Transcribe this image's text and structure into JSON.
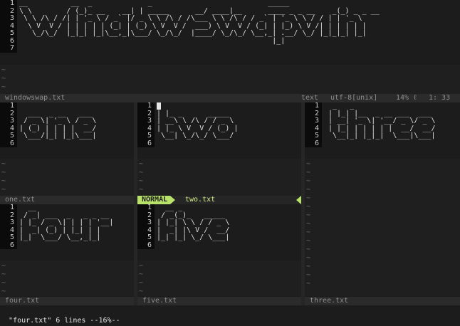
{
  "windows": {
    "top": {
      "file": "windowswap.txt",
      "lines": [
        "__          __  _             _                           _____                           ",
        "\\ \\        / (_)_ __    __| | _____      __/ ____|__      ____ _ _ __    _(_) _ _ __  ",
        " \\ \\ /\\ / /| | '_ \\ / _` |/ _ \\ \\ /\\ / /\\___ \\ \\ /\\ / / _` | '_ \\ \\ / / | | '_ \\ ",
        "  \\ V  V / | | | | | (_| | (_) \\ V  V /  ___) \\ V  V / (_| | |_) \\ V /| | | | | |",
        "   \\_/\\_/  |_|_| |_|\\__,_|\\___/ \\_/\\_/  |____/ \\_/\\_/ \\__,_| .__/ \\_/ |_|_|_| |_|",
        "                                                           |_|                      ",
        ""
      ],
      "line_numbers": [
        "1",
        "2",
        "3",
        "4",
        "5",
        "6",
        "7"
      ],
      "tildes": [
        "~",
        "~",
        "~"
      ],
      "filetype": "text",
      "encoding": "utf-8[unix]",
      "percent": "14%",
      "ln_icon": "ℓ",
      "position": "1: 33"
    },
    "one": {
      "file": "one.txt",
      "lines": [
        "",
        "  ___  _ __   ___ ",
        " / _ \\| '_ \\ / _ \\",
        "| (_) | | | |  __/",
        " \\___/|_| |_|\\___|",
        ""
      ],
      "line_numbers": [
        "1",
        "2",
        "3",
        "4",
        "5",
        "6"
      ],
      "tildes": [
        "~",
        "~",
        "~",
        "~"
      ]
    },
    "two": {
      "file": "two.txt",
      "mode": "NORMAL",
      "lines": [
        "",
        "| |_ _      _____  ",
        "| __\\ \\ /\\ / / _ \\ ",
        "| |_ \\ V  V / (_) |",
        " \\__| \\_/\\_/ \\___/ ",
        ""
      ],
      "line_numbers": [
        "1",
        "2",
        "3",
        "4",
        "5",
        "6"
      ],
      "tildes": [
        "~",
        "~",
        "~",
        "~"
      ]
    },
    "three": {
      "file": "three.txt",
      "lines": [
        "  _   _                    ",
        " | |_| |__  _ __ ___  ___ ",
        " | __| '_ \\| '__/ _ \\/ _ \\",
        " | |_| | | | | |  __/  __/",
        "  \\__|_| |_|_|  \\___|\\___|",
        ""
      ],
      "line_numbers": [
        "1",
        "2",
        "3",
        "4",
        "5",
        "6"
      ],
      "tildes": [
        "~",
        "~",
        "~",
        "~",
        "~",
        "~",
        "~",
        "~",
        "~",
        "~",
        "~",
        "~",
        "~",
        "~",
        "~",
        "~",
        "~"
      ]
    },
    "four": {
      "file": "four.txt",
      "lines": [
        "  __",
        " / _| ___  _   _ _ __ ",
        "| |_ / _ \\| | | | '__|",
        "|  _| (_) | |_| | |   ",
        "|_|  \\___/ \\__,_|_|   ",
        ""
      ],
      "line_numbers": [
        "1",
        "2",
        "3",
        "4",
        "5",
        "6"
      ],
      "tildes": [
        "~",
        "~",
        "~",
        "~"
      ]
    },
    "five": {
      "file": "five.txt",
      "lines": [
        "  __ _",
        " / _(_)_   _____ ",
        "| |_| \\ \\ / / _ \\",
        "|  _| |\\ V /  __/",
        "|_| |_| \\_/ \\___|",
        ""
      ],
      "line_numbers": [
        "1",
        "2",
        "3",
        "4",
        "5",
        "6"
      ],
      "tildes": [
        "~",
        "~",
        "~",
        "~"
      ]
    }
  },
  "cmdline": "\"four.txt\" 6 lines --16%--",
  "colors": {
    "mode_bg": "#b9e26b",
    "background": "#1c1c1c",
    "gutter": "#0b0b0b",
    "statusline": "#2b2b2b"
  }
}
